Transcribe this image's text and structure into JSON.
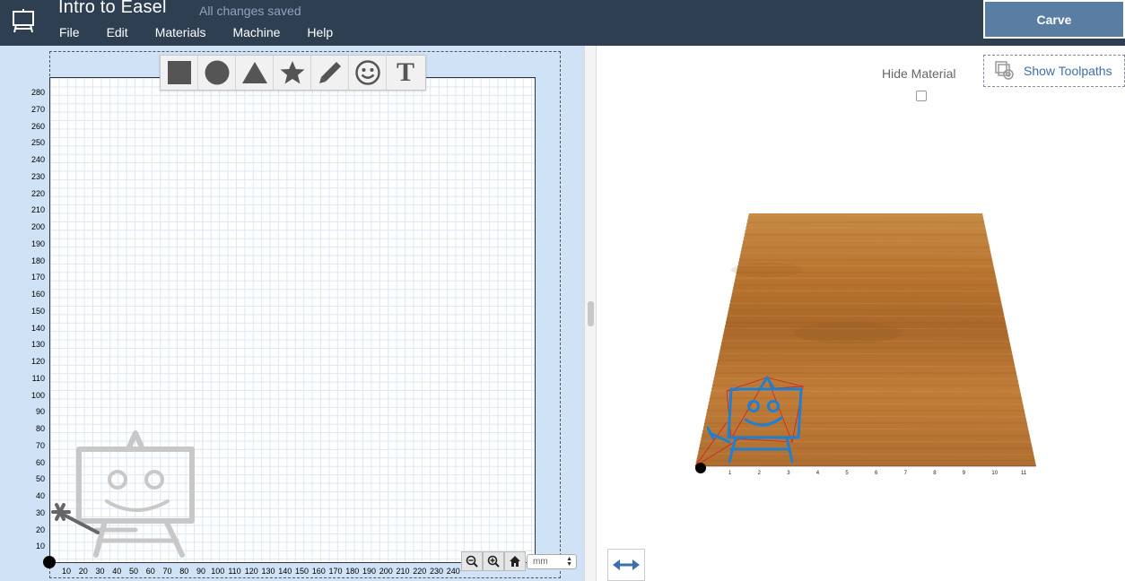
{
  "header": {
    "title": "Intro to Easel",
    "save_status": "All changes saved",
    "menu": [
      "File",
      "Edit",
      "Materials",
      "Machine",
      "Help"
    ],
    "carve_label": "Carve"
  },
  "toolbar": {
    "tools": [
      "square",
      "circle",
      "triangle",
      "star",
      "pencil",
      "smiley",
      "text"
    ],
    "text_tool_glyph": "T"
  },
  "design_canvas": {
    "y_ticks": [
      "280",
      "270",
      "260",
      "250",
      "240",
      "230",
      "220",
      "210",
      "200",
      "190",
      "180",
      "170",
      "160",
      "150",
      "140",
      "130",
      "120",
      "110",
      "100",
      "90",
      "80",
      "70",
      "60",
      "50",
      "40",
      "30",
      "20",
      "10"
    ],
    "x_ticks": [
      "10",
      "20",
      "30",
      "40",
      "50",
      "60",
      "70",
      "80",
      "90",
      "100",
      "110",
      "120",
      "130",
      "140",
      "150",
      "160",
      "170",
      "180",
      "190",
      "200",
      "210",
      "220",
      "230",
      "240"
    ],
    "units": "mm"
  },
  "preview": {
    "hide_material_label": "Hide Material",
    "hide_material_checked": false,
    "show_toolpaths_label": "Show Toolpaths",
    "x_ticks": [
      "1",
      "2",
      "3",
      "4",
      "5",
      "6",
      "7",
      "8",
      "9",
      "10",
      "11"
    ]
  },
  "colors": {
    "header_bg": "#2e3f52",
    "carve_bg": "#5a7ea3",
    "canvas_bg": "#cfe2f6",
    "toolpath_blue": "#1f7fd0",
    "toolpath_red": "#d0202a",
    "wood": "#b8742f"
  }
}
